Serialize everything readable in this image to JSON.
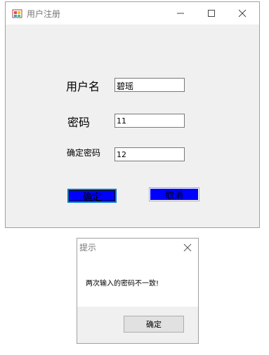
{
  "window": {
    "title": "用户注册",
    "icon": "app-form-icon",
    "controls": [
      "minimize-icon",
      "maximize-icon",
      "close-icon"
    ]
  },
  "form": {
    "username_label": "用户名",
    "username_value": "碧瑶",
    "password_label": "密码",
    "password_value": "11",
    "confirm_label": "确定密码",
    "confirm_value": "12",
    "ok_button": "确定",
    "cancel_button": "取消",
    "button_color": "#0000ff"
  },
  "dialog": {
    "title": "提示",
    "message": "两次输入的密码不一致!",
    "ok_button": "确定"
  }
}
